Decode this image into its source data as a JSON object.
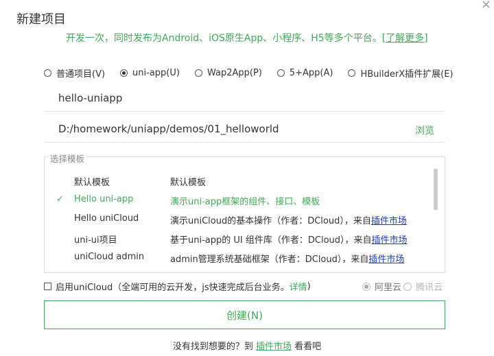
{
  "dialog": {
    "title": "新建项目",
    "close_icon": "×",
    "subtitle": "开发一次，同时发布为Android、iOS原生App、小程序、H5等多个平台。",
    "learn_more": "[了解更多]"
  },
  "project_types": [
    {
      "label": "普通项目(V)",
      "selected": false
    },
    {
      "label": "uni-app(U)",
      "selected": true
    },
    {
      "label": "Wap2App(P)",
      "selected": false
    },
    {
      "label": "5+App(A)",
      "selected": false
    },
    {
      "label": "HBuilderX插件扩展(E)",
      "selected": false
    }
  ],
  "project_name": {
    "value": "hello-uniapp"
  },
  "project_path": {
    "value": "D:/homework/uniapp/demos/01_helloworld",
    "browse_label": "浏览"
  },
  "templates": {
    "legend": "选择模板",
    "items": [
      {
        "name": "默认模板",
        "desc": "默认模板",
        "suffix": "",
        "link": "",
        "selected": false
      },
      {
        "name": "Hello uni-app",
        "desc": "演示uni-app框架的组件、接口、模板",
        "suffix": "",
        "link": "",
        "selected": true
      },
      {
        "name": "Hello uniCloud",
        "desc": "演示uniCloud的基本操作（作者：DCloud），来自",
        "suffix": "",
        "link": "插件市场",
        "selected": false
      },
      {
        "name": "uni-ui项目",
        "desc": "基于uni-app的 UI 组件库（作者：DCloud），来自",
        "suffix": "",
        "link": "插件市场",
        "selected": false
      },
      {
        "name": "uniCloud admin",
        "desc": "admin管理系统基础框架（作者：DCloud），来自",
        "suffix": "",
        "link": "插件市场",
        "selected": false
      }
    ],
    "check_mark": "✓"
  },
  "unicloud": {
    "label": "启用uniCloud（全端可用的云开发，js快速完成后台业务。",
    "details": "详情",
    "close_paren": ")",
    "providers": [
      {
        "label": "阿里云",
        "selected": true
      },
      {
        "label": "腾讯云",
        "selected": false
      }
    ]
  },
  "create_button": {
    "label": "创建(N)"
  },
  "footer": {
    "prefix": "没有找到想要的？到 ",
    "link": "插件市场",
    "suffix": " 看看吧"
  }
}
